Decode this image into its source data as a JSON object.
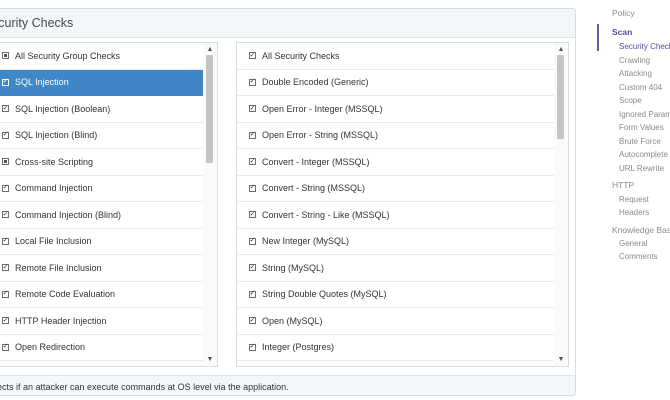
{
  "panel": {
    "title": "Security Checks",
    "description": "Detects if an attacker can execute commands at OS level via the application."
  },
  "left_list": {
    "items": [
      {
        "label": "All Security Group Checks",
        "state": "partial",
        "selected": false
      },
      {
        "label": "SQL Injection",
        "state": "checked",
        "selected": true
      },
      {
        "label": "SQL Injection (Boolean)",
        "state": "checked",
        "selected": false
      },
      {
        "label": "SQL Injection (Blind)",
        "state": "checked",
        "selected": false
      },
      {
        "label": "Cross-site Scripting",
        "state": "partial",
        "selected": false
      },
      {
        "label": "Command Injection",
        "state": "checked",
        "selected": false
      },
      {
        "label": "Command Injection (Blind)",
        "state": "checked",
        "selected": false
      },
      {
        "label": "Local File Inclusion",
        "state": "checked",
        "selected": false
      },
      {
        "label": "Remote File Inclusion",
        "state": "checked",
        "selected": false
      },
      {
        "label": "Remote Code Evaluation",
        "state": "checked",
        "selected": false
      },
      {
        "label": "HTTP Header Injection",
        "state": "checked",
        "selected": false
      },
      {
        "label": "Open Redirection",
        "state": "checked",
        "selected": false
      }
    ]
  },
  "right_list": {
    "items": [
      {
        "label": "All Security Checks",
        "state": "checked"
      },
      {
        "label": "Double Encoded (Generic)",
        "state": "checked"
      },
      {
        "label": "Open Error - Integer (MSSQL)",
        "state": "checked"
      },
      {
        "label": "Open Error - String (MSSQL)",
        "state": "checked"
      },
      {
        "label": "Convert - Integer (MSSQL)",
        "state": "checked"
      },
      {
        "label": "Convert - String (MSSQL)",
        "state": "checked"
      },
      {
        "label": "Convert - String - Like (MSSQL)",
        "state": "checked"
      },
      {
        "label": "New Integer (MySQL)",
        "state": "checked"
      },
      {
        "label": "String (MySQL)",
        "state": "checked"
      },
      {
        "label": "String Double Quotes (MySQL)",
        "state": "checked"
      },
      {
        "label": "Open (MySQL)",
        "state": "checked"
      },
      {
        "label": "Integer (Postgres)",
        "state": "checked"
      }
    ]
  },
  "scroll_arrows": {
    "up": "▲",
    "down": "▼"
  },
  "sidenav": {
    "items": [
      {
        "label": "Policy",
        "level": "section",
        "active": false
      },
      {
        "label": "Scan",
        "level": "section",
        "active": true
      },
      {
        "label": "Security Checks",
        "level": "sub",
        "active": true
      },
      {
        "label": "Crawling",
        "level": "sub",
        "active": false
      },
      {
        "label": "Attacking",
        "level": "sub",
        "active": false
      },
      {
        "label": "Custom 404",
        "level": "sub",
        "active": false
      },
      {
        "label": "Scope",
        "level": "sub",
        "active": false
      },
      {
        "label": "Ignored Parameters",
        "level": "sub",
        "active": false
      },
      {
        "label": "Form Values",
        "level": "sub",
        "active": false
      },
      {
        "label": "Brute Force",
        "level": "sub",
        "active": false
      },
      {
        "label": "Autocomplete",
        "level": "sub",
        "active": false
      },
      {
        "label": "URL Rewrite",
        "level": "sub",
        "active": false
      },
      {
        "label": "HTTP",
        "level": "section",
        "active": false
      },
      {
        "label": "Request",
        "level": "sub",
        "active": false
      },
      {
        "label": "Headers",
        "level": "sub",
        "active": false
      },
      {
        "label": "Knowledge Base",
        "level": "section",
        "active": false
      },
      {
        "label": "General",
        "level": "sub",
        "active": false
      },
      {
        "label": "Comments",
        "level": "sub",
        "active": false
      }
    ]
  },
  "colors": {
    "selected_row": "#3f87c6",
    "nav_accent": "#6c5aa8"
  }
}
